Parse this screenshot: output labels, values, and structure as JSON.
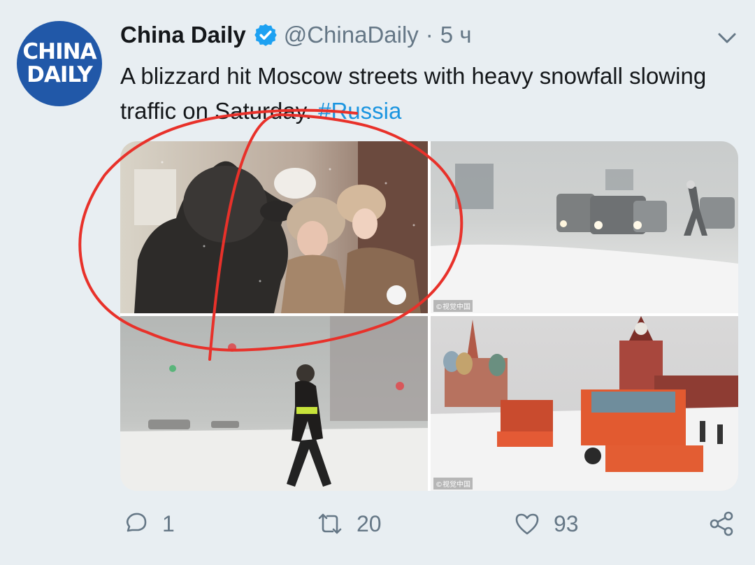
{
  "tweet": {
    "avatar": {
      "line1": "CHINA",
      "line2": "DAILY"
    },
    "author_name": "China Daily",
    "handle": "@ChinaDaily",
    "separator": "·",
    "time": "5 ч",
    "text": "A blizzard hit Moscow streets with heavy snowfall slowing traffic on Saturday.",
    "hashtag": "#Russia",
    "watermarks": [
      "©视觉中国",
      "©视觉中国"
    ]
  },
  "actions": {
    "replies": "1",
    "retweets": "20",
    "likes": "93"
  },
  "colors": {
    "background": "#e8eef2",
    "brand": "#2158a8",
    "link": "#1b95e0",
    "annotation": "#e8312a"
  },
  "icons": {
    "verified": "verified-badge-icon",
    "chevron": "chevron-down-icon",
    "reply": "reply-icon",
    "retweet": "retweet-icon",
    "like": "heart-icon",
    "share": "share-icon"
  }
}
